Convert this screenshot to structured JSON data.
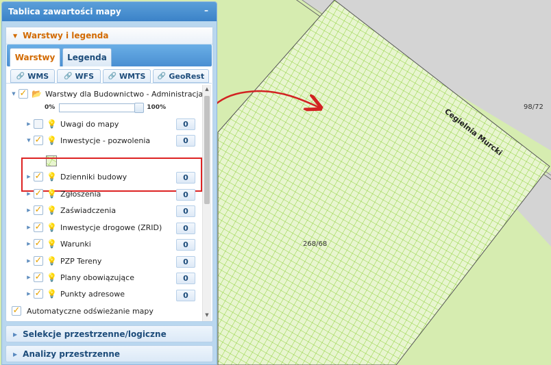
{
  "panel": {
    "title": "Tablica zawartości mapy",
    "minimize_glyph": "–",
    "layers_section": {
      "title": "Warstwy i legenda",
      "tabs": [
        "Warstwy",
        "Legenda"
      ],
      "service_tabs": [
        "WMS",
        "WFS",
        "WMTS",
        "GeoRest"
      ],
      "root_group": {
        "label": "Warstwy dla Budownictwo - Administracja",
        "opacity_min": "0%",
        "opacity_max": "100%",
        "opacity_value": 1.0
      },
      "layers": [
        {
          "label": "Uwagi do mapy",
          "count": "0",
          "checked": false
        },
        {
          "label": "Inwestycje - pozwolenia",
          "count": "0",
          "checked": true
        },
        {
          "label": "Dzienniki budowy",
          "count": "0",
          "checked": true
        },
        {
          "label": "Zgłoszenia",
          "count": "0",
          "checked": true
        },
        {
          "label": "Zaświadczenia",
          "count": "0",
          "checked": true
        },
        {
          "label": "Inwestycje drogowe (ZRID)",
          "count": "0",
          "checked": true
        },
        {
          "label": "Warunki",
          "count": "0",
          "checked": true
        },
        {
          "label": "PZP Tereny",
          "count": "0",
          "checked": true
        },
        {
          "label": "Plany obowiązujące",
          "count": "0",
          "checked": true
        },
        {
          "label": "Punkty adresowe",
          "count": "0",
          "checked": true
        }
      ],
      "auto_refresh_label": "Automatyczne odświeżanie mapy"
    },
    "selections_section": {
      "title": "Selekcje przestrzenne/logiczne"
    },
    "analyses_section": {
      "title": "Analizy przestrzenne"
    }
  },
  "map": {
    "street_label": "Cegielnia Murcki",
    "parcel_labels": [
      "98/72",
      "268/68"
    ],
    "colors": {
      "background": "#d6ecb0",
      "road": "#d4d4d4",
      "hatch": "#8fd23a",
      "arrow": "#d22222"
    }
  }
}
